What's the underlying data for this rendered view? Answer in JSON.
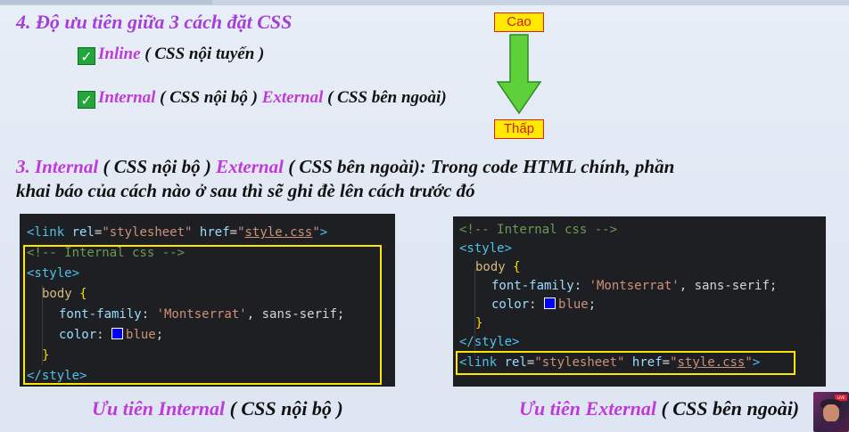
{
  "priority": {
    "heading": "4.   Độ ưu tiên giữa 3 cách đặt CSS",
    "item1": {
      "name": "Inline",
      "note": " ( CSS nội tuyến )"
    },
    "item2": {
      "name1": "Internal",
      "note1": " ( CSS nội bộ ) ",
      "name2": "External",
      "note2": " ( CSS bên ngoài)"
    },
    "high_label": "Cao",
    "low_label": "Thấp",
    "check_glyph": "✓"
  },
  "section3": {
    "prefix": "3. ",
    "internal": "Internal",
    "internal_note": " ( CSS nội bộ ) ",
    "external": "External",
    "rest1": " ( CSS bên ngoài): Trong code HTML chính, phần",
    "line2": "khai báo của cách nào ở sau thì sẽ ghi đè lên cách trước đó"
  },
  "code_left": {
    "link": {
      "open": "<link ",
      "rel_attr": "rel",
      "eq": "=",
      "rel_val": "\"stylesheet\"",
      "href_attr": "href",
      "href_q1": "\"",
      "href_val": "style.css",
      "href_q2": "\"",
      "close": ">"
    },
    "comment": "<!-- Internal css -->",
    "style_open": "<style>",
    "selector": "body",
    "brace_open": " {",
    "prop1": "font-family",
    "colon": ": ",
    "val1": "'Montserrat'",
    "val1b": ", sans-serif",
    "semi": ";",
    "prop2": "color",
    "val2": "blue",
    "brace_close": "}",
    "style_close": "</style>"
  },
  "code_right": {
    "comment": "<!-- Internal css -->",
    "style_open": "<style>",
    "selector": "body",
    "brace_open": " {",
    "prop1": "font-family",
    "colon": ": ",
    "val1": "'Montserrat'",
    "val1b": ", sans-serif",
    "semi": ";",
    "prop2": "color",
    "val2": "blue",
    "brace_close": "}",
    "style_close": "</style>",
    "link": {
      "open": "<link ",
      "rel_attr": "rel",
      "eq": "=",
      "rel_val": "\"stylesheet\"",
      "href_attr": "href",
      "href_q1": "\"",
      "href_val": "style.css",
      "href_q2": "\"",
      "close": ">"
    }
  },
  "captions": {
    "left_prefix": "Ưu tiên ",
    "left_name": "Internal",
    "left_note": " ( CSS nội bộ )",
    "right_prefix": "Ưu tiên ",
    "right_name": "External",
    "right_note": " ( CSS bên ngoài)"
  },
  "colors": {
    "heading_purple": "#a43fd8",
    "accent_magenta": "#c03ad8",
    "highlight_yellow": "#ffe600",
    "arrow_green": "#5ed03a",
    "code_bg": "#1e1f22"
  },
  "avatar_badge": "LIVE"
}
